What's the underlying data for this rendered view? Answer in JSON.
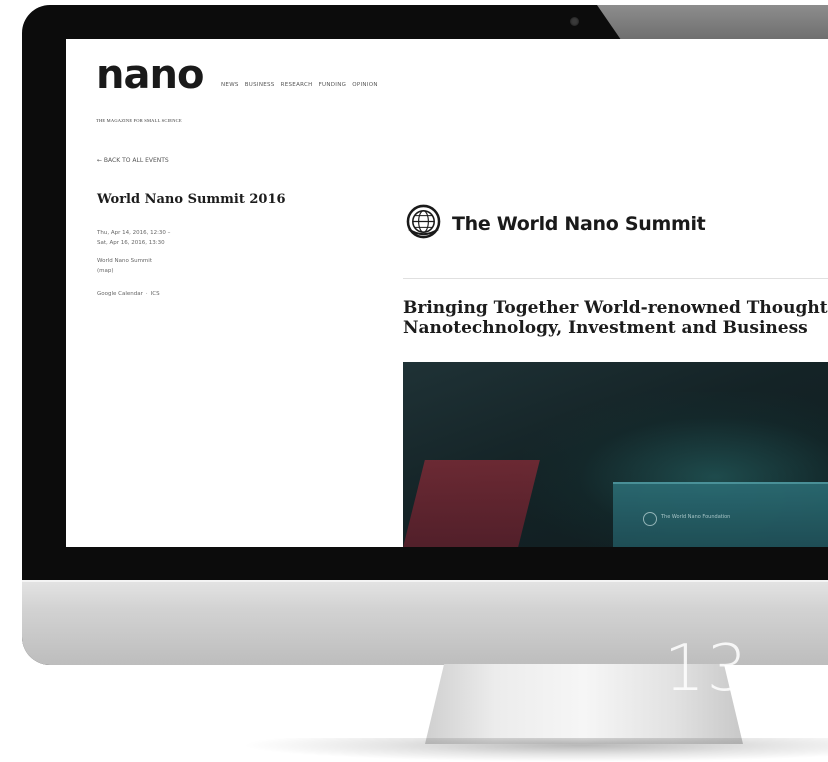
{
  "site": {
    "logo": "nano",
    "tagline": "THE MAGAZINE FOR SMALL SCIENCE",
    "nav": [
      "NEWS",
      "BUSINESS",
      "RESEARCH",
      "FUNDING",
      "OPINION"
    ]
  },
  "event": {
    "back_link": "← BACK TO ALL EVENTS",
    "title": "World Nano Summit 2016",
    "date_line_1": "Thu, Apr 14, 2016, 12:30 –",
    "date_line_2": "Sat, Apr 16, 2016, 13:30",
    "location": "World Nano Summit",
    "map_link": "(map)",
    "calendar_link": "Google Calendar",
    "separator": "·",
    "ics_link": "ICS"
  },
  "summit": {
    "name": "The World Nano Summit",
    "headline_line_1": "Bringing Together World-renowned Thought",
    "headline_line_2": "Nanotechnology, Investment and Business",
    "hero_caption": "The World Nano Foundation"
  },
  "slide_number": "13"
}
